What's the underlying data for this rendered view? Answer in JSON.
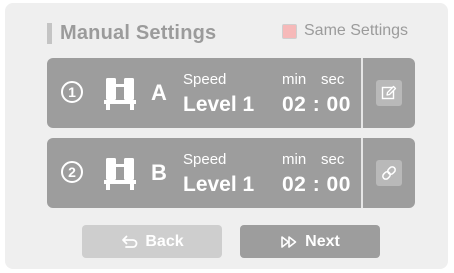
{
  "header": {
    "title": "Manual Settings",
    "same_settings_label": "Same Settings",
    "same_settings_checked": false
  },
  "cards": [
    {
      "number": "1",
      "letter": "A",
      "speed_label": "Speed",
      "level": "Level 1",
      "min_label": "min",
      "sec_label": "sec",
      "time": "02 : 00",
      "action_icon": "edit-icon"
    },
    {
      "number": "2",
      "letter": "B",
      "speed_label": "Speed",
      "level": "Level 1",
      "min_label": "min",
      "sec_label": "sec",
      "time": "02 : 00",
      "action_icon": "link-icon"
    }
  ],
  "buttons": {
    "back_label": "Back",
    "next_label": "Next"
  },
  "colors": {
    "card": "#9d9d9d",
    "panel": "#efefef",
    "checkbox_fill": "#f6b9b9",
    "back_disabled": "#cecece"
  }
}
